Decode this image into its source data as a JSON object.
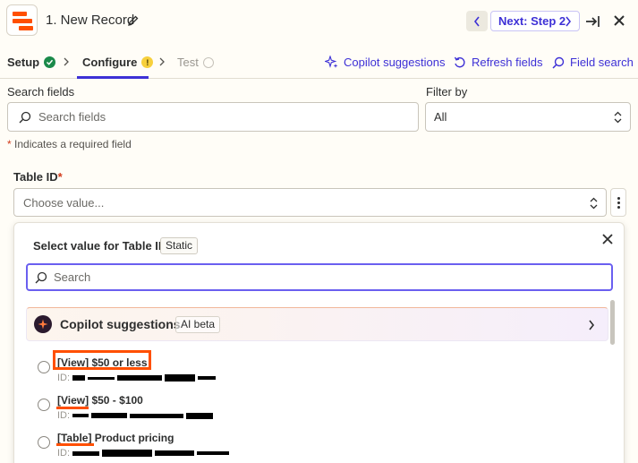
{
  "header": {
    "title": "1. New Record",
    "next_label": "Next: Step 2",
    "colors": {
      "brand": "#ff4f00",
      "accent": "#3d30d6"
    }
  },
  "steps": [
    {
      "label": "Setup",
      "status": "complete"
    },
    {
      "label": "Configure",
      "status": "warning"
    },
    {
      "label": "Test",
      "status": "disabled"
    }
  ],
  "actions": {
    "copilot": "Copilot suggestions",
    "refresh": "Refresh fields",
    "search": "Field search"
  },
  "search_fields": {
    "label": "Search fields",
    "placeholder": "Search fields"
  },
  "filter": {
    "label": "Filter by",
    "value": "All"
  },
  "required_note": "Indicates a required field",
  "table_id": {
    "label": "Table ID",
    "placeholder": "Choose value..."
  },
  "panel": {
    "title": "Select value for Table ID",
    "tag": "Static",
    "search_placeholder": "Search",
    "copilot": {
      "label": "Copilot suggestions",
      "badge": "AI beta"
    },
    "options": [
      {
        "label": "[View] $50 or less",
        "id_prefix": "ID:"
      },
      {
        "label": "[View] $50 - $100",
        "id_prefix": "ID:"
      },
      {
        "label": "[Table] Product pricing",
        "id_prefix": "ID:"
      }
    ]
  }
}
